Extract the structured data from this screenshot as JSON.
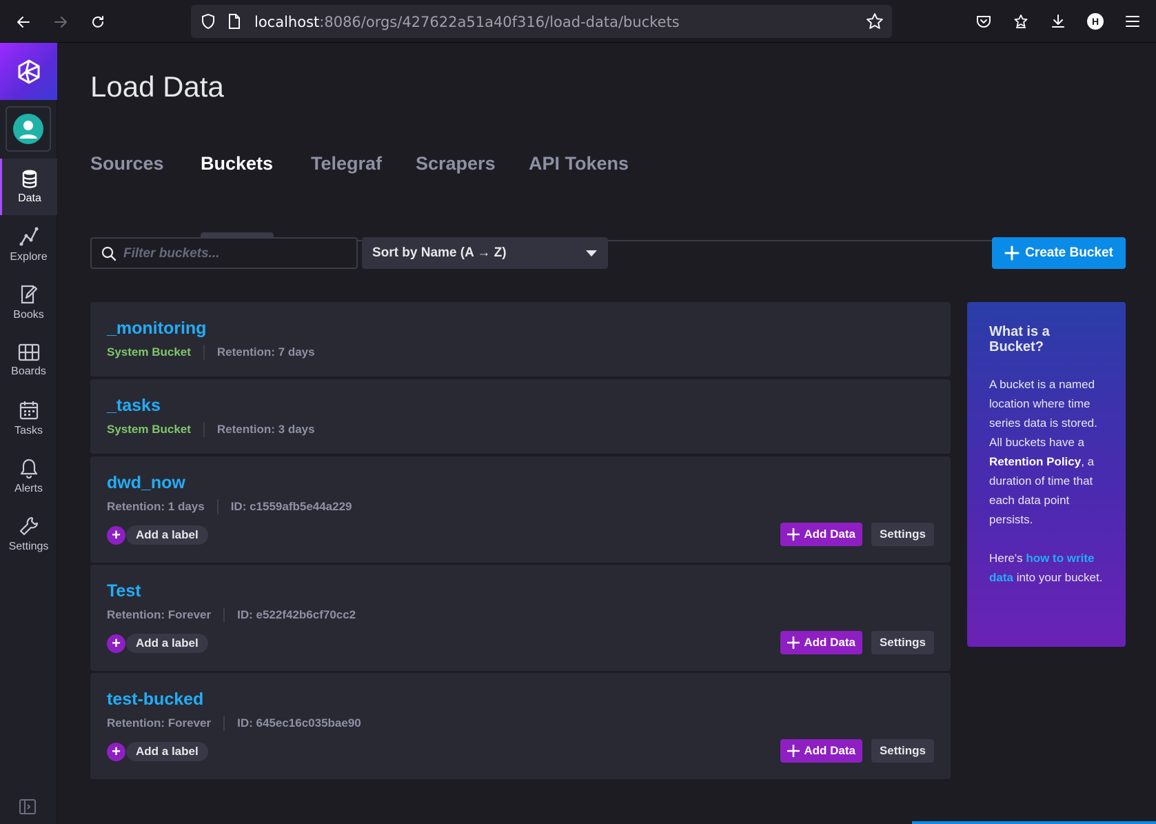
{
  "browser": {
    "url_host": "localhost",
    "url_rest": ":8086/orgs/427622a51a40f316/load-data/buckets",
    "profile_initial": "H"
  },
  "nav": {
    "items": [
      {
        "label": "Data",
        "icon": "database-icon"
      },
      {
        "label": "Explore",
        "icon": "graph-icon"
      },
      {
        "label": "Books",
        "icon": "notebook-icon"
      },
      {
        "label": "Boards",
        "icon": "grid-icon"
      },
      {
        "label": "Tasks",
        "icon": "calendar-icon"
      },
      {
        "label": "Alerts",
        "icon": "bell-icon"
      },
      {
        "label": "Settings",
        "icon": "wrench-icon"
      }
    ]
  },
  "page": {
    "title": "Load Data",
    "tabs": [
      "Sources",
      "Buckets",
      "Telegraf",
      "Scrapers",
      "API Tokens"
    ],
    "active_tab": "Buckets"
  },
  "toolbar": {
    "filter_placeholder": "Filter buckets...",
    "sort_label": "Sort by Name (A → Z)",
    "create_label": "Create Bucket"
  },
  "buckets": [
    {
      "name": "_monitoring",
      "system": "System Bucket",
      "retention": "Retention: 7 days"
    },
    {
      "name": "_tasks",
      "system": "System Bucket",
      "retention": "Retention: 3 days"
    },
    {
      "name": "dwd_now",
      "retention": "Retention: 1 days",
      "id": "ID: c1559afb5e44a229",
      "label_btn": "Add a label",
      "add_data": "Add Data",
      "settings": "Settings"
    },
    {
      "name": "Test",
      "retention": "Retention: Forever",
      "id": "ID: e522f42b6cf70cc2",
      "label_btn": "Add a label",
      "add_data": "Add Data",
      "settings": "Settings"
    },
    {
      "name": "test-bucked",
      "retention": "Retention: Forever",
      "id": "ID: 645ec16c035bae90",
      "label_btn": "Add a label",
      "add_data": "Add Data",
      "settings": "Settings"
    }
  ],
  "help": {
    "title": "What is a Bucket?",
    "p1_a": "A bucket is a named location where time series data is stored. All buckets have a ",
    "p1_b": "Retention Policy",
    "p1_c": ", a duration of time that each data point persists.",
    "p2_a": "Here's ",
    "p2_link": "how to write data",
    "p2_c": " into your bucket."
  },
  "colors": {
    "accent_blue": "#0b8be8",
    "bucket_name": "#22adf6",
    "system_green": "#7ec86b",
    "purple": "#8e1fc3"
  }
}
